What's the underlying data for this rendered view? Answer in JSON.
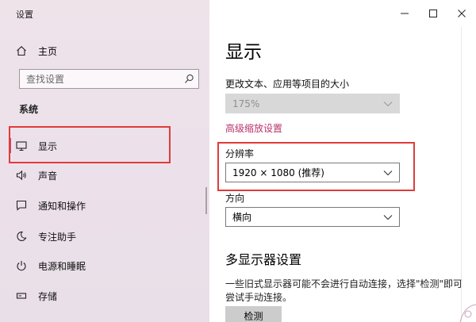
{
  "window": {
    "title": "设置",
    "controls": {
      "minimize": "minimize",
      "maximize": "maximize",
      "close": "close"
    }
  },
  "sidebar": {
    "home_label": "主页",
    "search": {
      "placeholder": "查找设置"
    },
    "section_label": "系统",
    "items": [
      {
        "label": "显示",
        "icon": "monitor-icon",
        "selected": true
      },
      {
        "label": "声音",
        "icon": "speaker-icon"
      },
      {
        "label": "通知和操作",
        "icon": "notification-icon"
      },
      {
        "label": "专注助手",
        "icon": "moon-icon"
      },
      {
        "label": "电源和睡眠",
        "icon": "power-icon"
      },
      {
        "label": "存储",
        "icon": "storage-icon"
      }
    ]
  },
  "main": {
    "page_title": "显示",
    "scale_label": "更改文本、应用等项目的大小",
    "scale_value": "175%",
    "advanced_scaling_link": "高级缩放设置",
    "resolution_label": "分辨率",
    "resolution_value": "1920 × 1080 (推荐)",
    "orientation_label": "方向",
    "orientation_value": "横向",
    "multi_display_title": "多显示器设置",
    "multi_display_desc": "一些旧式显示器可能不会进行自动连接，选择\"检测\"即可尝试手动连接。",
    "detect_button": "检测"
  },
  "colors": {
    "accent": "#c04a7d",
    "highlight": "#e03b3b",
    "sidebar_bg": "#ece1ea"
  }
}
